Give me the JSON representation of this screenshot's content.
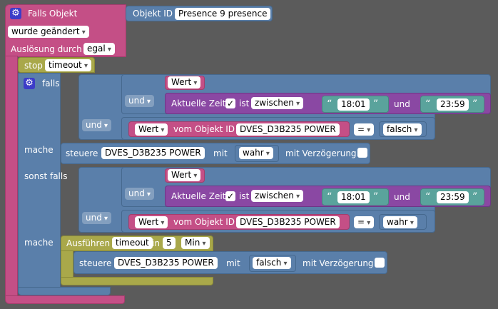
{
  "trigger": {
    "title": "Falls Objekt",
    "object_id_label": "Objekt ID",
    "object_id_value": "Presence 9 presence",
    "condition": "wurde geändert",
    "trigger_label": "Auslösung durch",
    "trigger_value": "egal"
  },
  "stop": {
    "label": "stop",
    "value": "timeout"
  },
  "if_block": {
    "if_label": "falls",
    "elseif_label": "sonst falls",
    "do_label": "mache",
    "branch1": {
      "wert": "Wert",
      "und1": "und",
      "time_label": "Aktuelle Zeit",
      "ist": "ist",
      "between": "zwischen",
      "time_from": "18:01",
      "und_between": "und",
      "time_to": "23:59",
      "und2": "und",
      "compare_wert": "Wert",
      "vom_objekt": "vom Objekt ID",
      "object": "DVES_D3B235 POWER",
      "op": "=",
      "compare_value": "falsch"
    },
    "do1": {
      "steuere": "steuere",
      "object": "DVES_D3B235 POWER",
      "mit": "mit",
      "value": "wahr",
      "delay": "mit Verzögerung"
    },
    "branch2": {
      "wert": "Wert",
      "und1": "und",
      "time_label": "Aktuelle Zeit",
      "ist": "ist",
      "between": "zwischen",
      "time_from": "18:01",
      "und_between": "und",
      "time_to": "23:59",
      "und2": "und",
      "compare_wert": "Wert",
      "vom_objekt": "vom Objekt ID",
      "object": "DVES_D3B235 POWER",
      "op": "=",
      "compare_value": "wahr"
    },
    "do2": {
      "execute_label": "Ausführen",
      "timeout_name": "timeout",
      "in": "in",
      "amount": "5",
      "unit": "Min",
      "steuere": "steuere",
      "object": "DVES_D3B235 POWER",
      "mit": "mit",
      "value": "falsch",
      "delay": "mit Verzögerung"
    }
  },
  "icons": {
    "gear": "gear-icon",
    "check": "checkmark-icon"
  },
  "colors": {
    "background": "#5b5b5b",
    "trigger": "#c44f86",
    "stop": "#a9a84a",
    "logic": "#5a7faa",
    "time": "#8a48a3",
    "text": "#5aa39c"
  }
}
